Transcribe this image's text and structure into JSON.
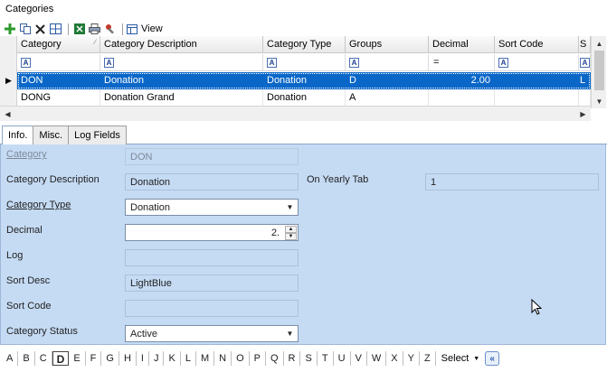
{
  "window": {
    "title": "Categories"
  },
  "toolbar": {
    "icons": [
      "add-icon",
      "copy-icon",
      "delete-icon",
      "layout-icon",
      "excel-icon",
      "print-icon",
      "tools-icon"
    ],
    "view_label": "View"
  },
  "grid": {
    "columns": [
      "Category",
      "Category Description",
      "Category Type",
      "Groups",
      "Decimal",
      "Sort Code",
      "S"
    ],
    "filter_decimal": "=",
    "rows": [
      {
        "cells": [
          "DON",
          "Donation",
          "Donation",
          "D",
          "2.00",
          "",
          "L"
        ],
        "selected": true
      },
      {
        "cells": [
          "DONG",
          "Donation Grand",
          "Donation",
          "A",
          "",
          "",
          ""
        ],
        "selected": false
      }
    ]
  },
  "tabs": [
    {
      "label": "Info.",
      "active": true
    },
    {
      "label": "Misc.",
      "active": false
    },
    {
      "label": "Log Fields",
      "active": false
    }
  ],
  "form": {
    "category": {
      "label": "Category",
      "value": "DON"
    },
    "category_description": {
      "label": "Category Description",
      "value": "Donation"
    },
    "on_yearly_tab": {
      "label": "On Yearly Tab",
      "value": "1"
    },
    "category_type": {
      "label": "Category Type",
      "value": "Donation"
    },
    "decimal": {
      "label": "Decimal",
      "value": "2."
    },
    "log": {
      "label": "Log",
      "value": ""
    },
    "sort_desc": {
      "label": "Sort Desc",
      "value": "LightBlue"
    },
    "sort_code": {
      "label": "Sort Code",
      "value": ""
    },
    "category_status": {
      "label": "Category Status",
      "value": "Active"
    }
  },
  "alphabet": {
    "letters": [
      "A",
      "B",
      "C",
      "D",
      "E",
      "F",
      "G",
      "H",
      "I",
      "J",
      "K",
      "L",
      "M",
      "N",
      "O",
      "P",
      "Q",
      "R",
      "S",
      "T",
      "U",
      "V",
      "W",
      "X",
      "Y",
      "Z"
    ],
    "active": "D",
    "select_label": "Select"
  },
  "colors": {
    "panel_bg": "#c5dbf4",
    "selection": "#0a67c8"
  }
}
